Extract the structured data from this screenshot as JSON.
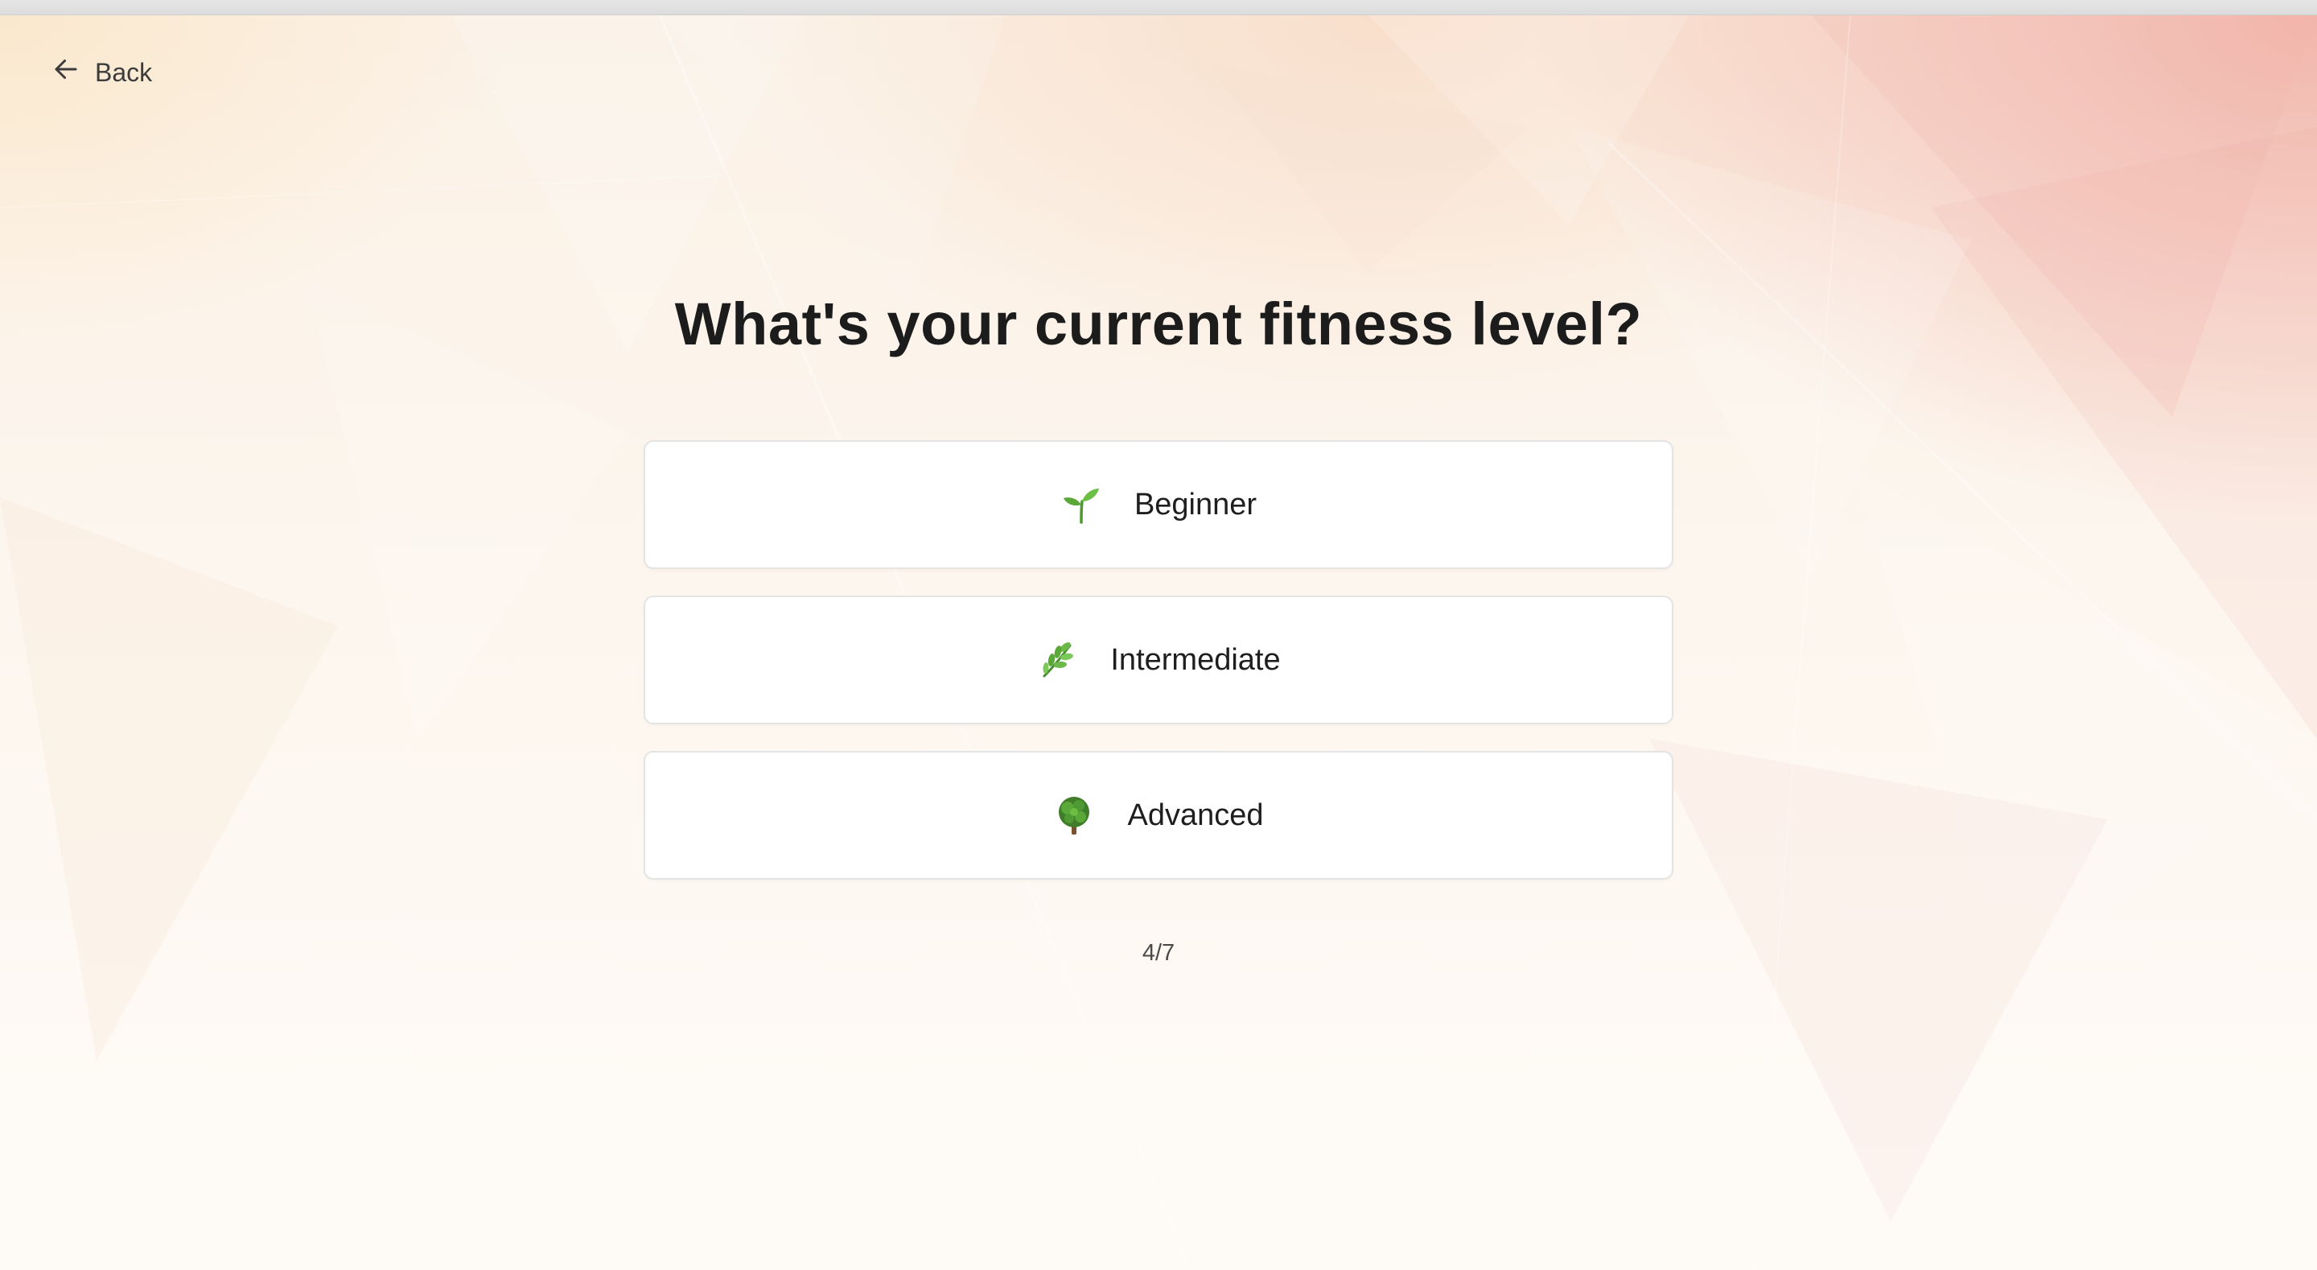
{
  "nav": {
    "back_label": "Back"
  },
  "question": {
    "title": "What's your current fitness level?"
  },
  "options": [
    {
      "icon": "seedling-icon",
      "label": "Beginner"
    },
    {
      "icon": "herb-icon",
      "label": "Intermediate"
    },
    {
      "icon": "tree-icon",
      "label": "Advanced"
    }
  ],
  "progress": {
    "text": "4/7",
    "current": 4,
    "total": 7
  },
  "colors": {
    "background_warm": "#fbf1e6",
    "background_accent": "#eea096",
    "card": "#ffffff",
    "card_border": "#e4e4e4",
    "text": "#1c1c1c",
    "leaf_green": "#5fae3e"
  }
}
